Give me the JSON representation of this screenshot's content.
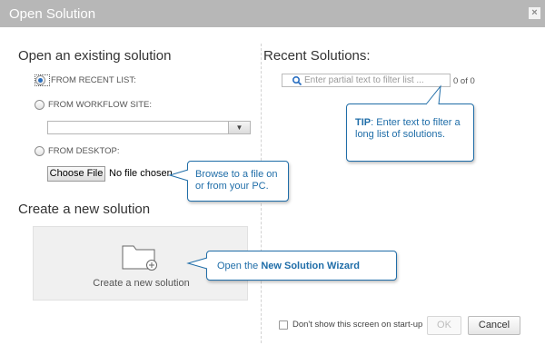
{
  "window": {
    "title": "Open Solution",
    "close_label": "×"
  },
  "open_section": {
    "title": "Open an existing solution",
    "options": [
      {
        "label": "FROM RECENT LIST:",
        "checked": true
      },
      {
        "label": "FROM WORKFLOW SITE:",
        "checked": false
      },
      {
        "label": "FROM DESKTOP:",
        "checked": false
      }
    ],
    "workflow_select_value": "",
    "choose_file_label": "Choose File",
    "no_file_label": "No file chosen"
  },
  "create_section": {
    "title": "Create a new solution",
    "tile_label": "Create a new solution"
  },
  "recent_section": {
    "title": "Recent Solutions:",
    "filter_placeholder": "Enter partial text to filter list ...",
    "count": "0 of 0"
  },
  "callouts": {
    "tip_strong": "TIP",
    "tip_text": ": Enter text to filter a long list of solutions.",
    "browse_text": "Browse to a file on or from your PC.",
    "wizard_prefix": "Open the ",
    "wizard_strong": "New Solution Wizard"
  },
  "footer": {
    "dont_show_label": "Don't show this screen on start-up",
    "ok_label": "OK",
    "cancel_label": "Cancel"
  },
  "colors": {
    "titlebar": "#b7b7b7",
    "accent": "#1f6da8",
    "tile_bg": "#f0f0f0"
  }
}
